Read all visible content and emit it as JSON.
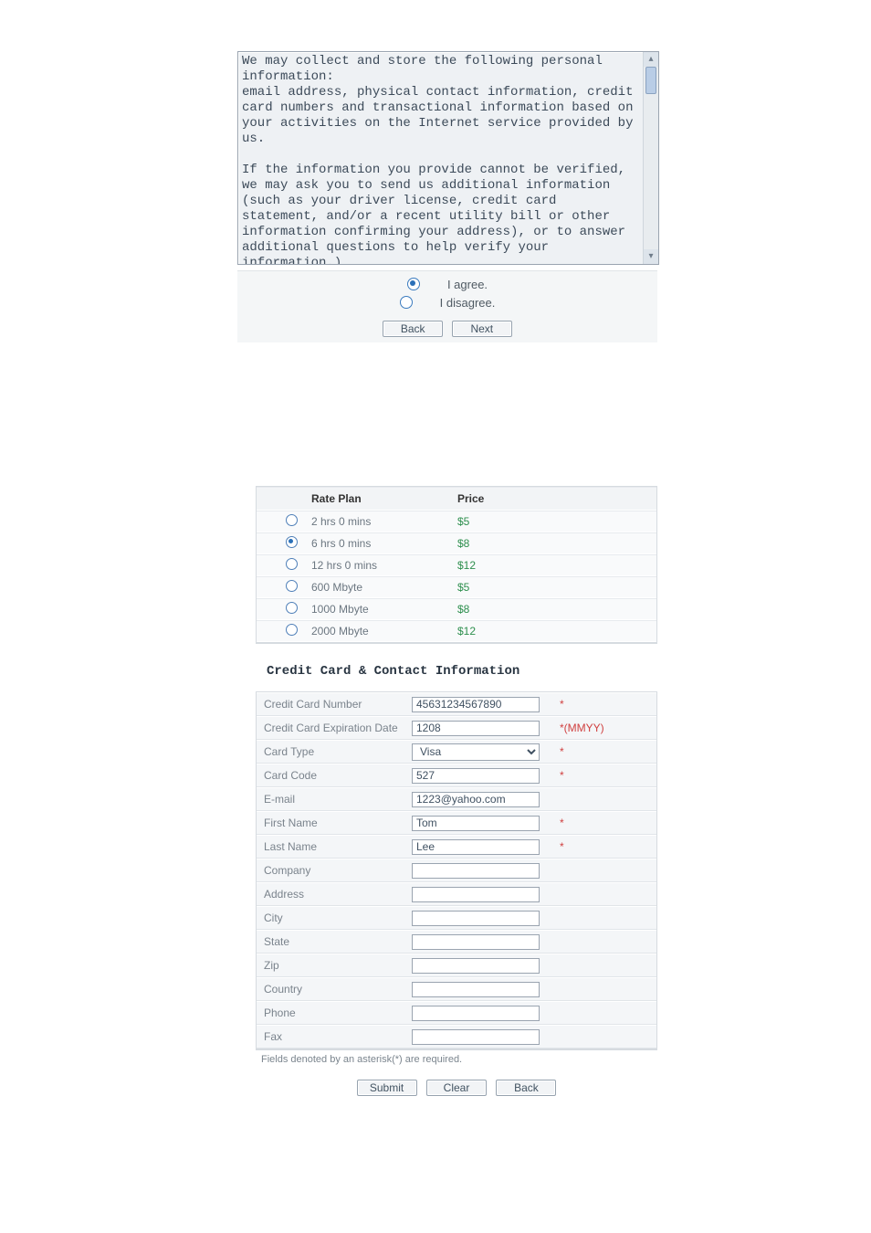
{
  "terms_text": "We may collect and store the following personal\ninformation:\nemail address, physical contact information, credit\ncard numbers and transactional information based on\nyour activities on the Internet service provided by\nus.\n\nIf the information you provide cannot be verified,\nwe may ask you to send us additional information\n(such as your driver license, credit card\nstatement, and/or a recent utility bill or other\ninformation confirming your address), or to answer\nadditional questions to help verify your\ninformation.)",
  "agree": {
    "selected_index": 0,
    "options": [
      "I agree.",
      "I disagree."
    ],
    "back_label": "Back",
    "next_label": "Next"
  },
  "rate": {
    "header_plan": "Rate Plan",
    "header_price": "Price",
    "selected_index": 1,
    "rows": [
      {
        "plan": "2 hrs 0 mins",
        "price": "$5"
      },
      {
        "plan": "6 hrs 0 mins",
        "price": "$8"
      },
      {
        "plan": "12 hrs 0 mins",
        "price": "$12"
      },
      {
        "plan": "600 Mbyte",
        "price": "$5"
      },
      {
        "plan": "1000 Mbyte",
        "price": "$8"
      },
      {
        "plan": "2000 Mbyte",
        "price": "$12"
      }
    ]
  },
  "section_title": "Credit Card & Contact Information",
  "form": {
    "fields": {
      "cc_number": {
        "label": "Credit Card Number",
        "value": "45631234567890",
        "required": true,
        "hint": ""
      },
      "cc_exp": {
        "label": "Credit Card Expiration Date",
        "value": "1208",
        "required": true,
        "hint": "(MMYY)"
      },
      "card_type": {
        "label": "Card Type",
        "value": "Visa",
        "required": true,
        "hint": ""
      },
      "card_code": {
        "label": "Card Code",
        "value": "527",
        "required": true,
        "hint": ""
      },
      "email": {
        "label": "E-mail",
        "value": "1223@yahoo.com",
        "required": false,
        "hint": ""
      },
      "first_name": {
        "label": "First Name",
        "value": "Tom",
        "required": true,
        "hint": ""
      },
      "last_name": {
        "label": "Last Name",
        "value": "Lee",
        "required": true,
        "hint": ""
      },
      "company": {
        "label": "Company",
        "value": "",
        "required": false,
        "hint": ""
      },
      "address": {
        "label": "Address",
        "value": "",
        "required": false,
        "hint": ""
      },
      "city": {
        "label": "City",
        "value": "",
        "required": false,
        "hint": ""
      },
      "state": {
        "label": "State",
        "value": "",
        "required": false,
        "hint": ""
      },
      "zip": {
        "label": "Zip",
        "value": "",
        "required": false,
        "hint": ""
      },
      "country": {
        "label": "Country",
        "value": "",
        "required": false,
        "hint": ""
      },
      "phone": {
        "label": "Phone",
        "value": "",
        "required": false,
        "hint": ""
      },
      "fax": {
        "label": "Fax",
        "value": "",
        "required": false,
        "hint": ""
      }
    },
    "note": "Fields denoted by an asterisk(*) are required.",
    "submit_label": "Submit",
    "clear_label": "Clear",
    "back_label": "Back"
  }
}
